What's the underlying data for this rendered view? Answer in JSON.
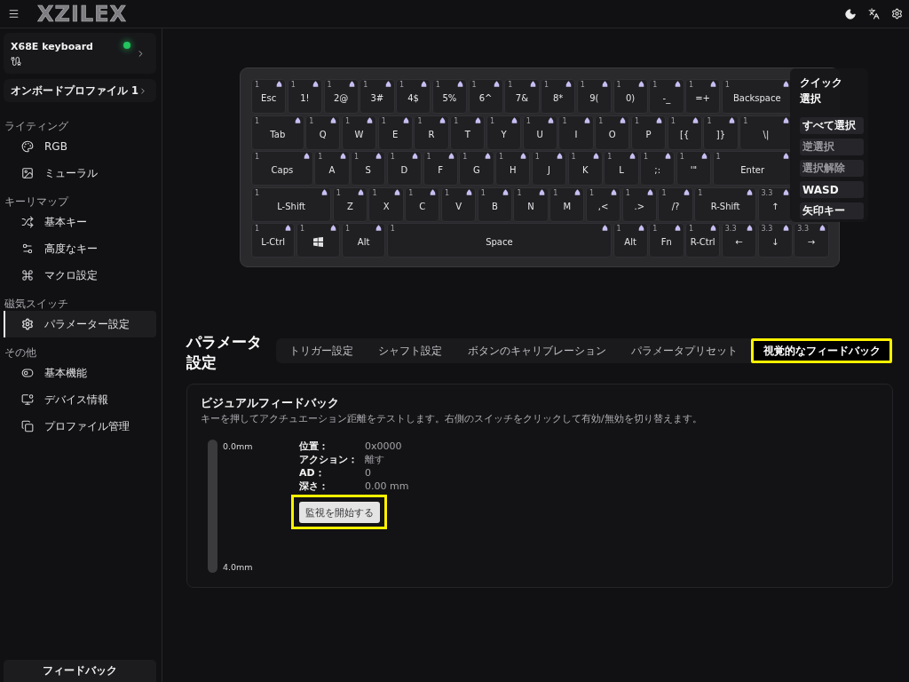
{
  "top_bar": {
    "logo": "XZILEX"
  },
  "sidebar": {
    "device": {
      "name": "X68E keyboard",
      "connected": true
    },
    "profile": "オンボードプロファイル 1",
    "sections": [
      {
        "title": "ライティング",
        "items": [
          {
            "label": "RGB",
            "selected": false
          },
          {
            "label": "ミューラル",
            "selected": false
          }
        ]
      },
      {
        "title": "キーリマップ",
        "items": [
          {
            "label": "基本キー",
            "selected": false
          },
          {
            "label": "高度なキー",
            "selected": false
          },
          {
            "label": "マクロ設定",
            "selected": false
          }
        ]
      },
      {
        "title": "磁気スイッチ",
        "items": [
          {
            "label": "パラメーター設定",
            "selected": true
          }
        ]
      },
      {
        "title": "その他",
        "items": [
          {
            "label": "基本機能",
            "selected": false
          },
          {
            "label": "デバイス情報",
            "selected": false
          },
          {
            "label": "プロファイル管理",
            "selected": false
          }
        ]
      }
    ],
    "feedback_button": "フィードバック"
  },
  "keyboard": {
    "rows": [
      {
        "keys": [
          {
            "kind": "text",
            "label": "Esc",
            "value": "1"
          },
          {
            "kind": "text",
            "label": "1!",
            "value": "1"
          },
          {
            "kind": "text",
            "label": "2@",
            "value": "1"
          },
          {
            "kind": "text",
            "label": "3#",
            "value": "1"
          },
          {
            "kind": "text",
            "label": "4$",
            "value": "1"
          },
          {
            "kind": "text",
            "label": "5%",
            "value": "1"
          },
          {
            "kind": "text",
            "label": "6^",
            "value": "1"
          },
          {
            "kind": "text",
            "label": "7&",
            "value": "1"
          },
          {
            "kind": "text",
            "label": "8*",
            "value": "1"
          },
          {
            "kind": "text",
            "label": "9(",
            "value": "1"
          },
          {
            "kind": "text",
            "label": "0)",
            "value": "1"
          },
          {
            "kind": "text",
            "label": "-_",
            "value": "1"
          },
          {
            "kind": "text",
            "label": "=+",
            "value": "1"
          },
          {
            "kind": "text",
            "label": "Backspace",
            "value": "1"
          }
        ]
      },
      {
        "keys": [
          {
            "kind": "text",
            "label": "Tab",
            "value": "1"
          },
          {
            "kind": "text",
            "label": "Q",
            "value": "1"
          },
          {
            "kind": "text",
            "label": "W",
            "value": "1"
          },
          {
            "kind": "text",
            "label": "E",
            "value": "1"
          },
          {
            "kind": "text",
            "label": "R",
            "value": "1"
          },
          {
            "kind": "text",
            "label": "T",
            "value": "1"
          },
          {
            "kind": "text",
            "label": "Y",
            "value": "1"
          },
          {
            "kind": "text",
            "label": "U",
            "value": "1"
          },
          {
            "kind": "text",
            "label": "I",
            "value": "1"
          },
          {
            "kind": "text",
            "label": "O",
            "value": "1"
          },
          {
            "kind": "text",
            "label": "P",
            "value": "1"
          },
          {
            "kind": "text",
            "label": "[{",
            "value": "1"
          },
          {
            "kind": "text",
            "label": "]}",
            "value": "1"
          },
          {
            "kind": "text",
            "label": "\\|",
            "value": "1"
          }
        ]
      },
      {
        "keys": [
          {
            "kind": "text",
            "label": "Caps",
            "value": "1"
          },
          {
            "kind": "text",
            "label": "A",
            "value": "1"
          },
          {
            "kind": "text",
            "label": "S",
            "value": "1"
          },
          {
            "kind": "text",
            "label": "D",
            "value": "1"
          },
          {
            "kind": "text",
            "label": "F",
            "value": "1"
          },
          {
            "kind": "text",
            "label": "G",
            "value": "1"
          },
          {
            "kind": "text",
            "label": "H",
            "value": "1"
          },
          {
            "kind": "text",
            "label": "J",
            "value": "1"
          },
          {
            "kind": "text",
            "label": "K",
            "value": "1"
          },
          {
            "kind": "text",
            "label": "L",
            "value": "1"
          },
          {
            "kind": "text",
            "label": ";:",
            "value": "1"
          },
          {
            "kind": "text",
            "label": "'\"",
            "value": "1"
          },
          {
            "kind": "text",
            "label": "Enter",
            "value": "1"
          }
        ]
      },
      {
        "keys": [
          {
            "kind": "text",
            "label": "L-Shift",
            "value": "1"
          },
          {
            "kind": "text",
            "label": "Z",
            "value": "1"
          },
          {
            "kind": "text",
            "label": "X",
            "value": "1"
          },
          {
            "kind": "text",
            "label": "C",
            "value": "1"
          },
          {
            "kind": "text",
            "label": "V",
            "value": "1"
          },
          {
            "kind": "text",
            "label": "B",
            "value": "1"
          },
          {
            "kind": "text",
            "label": "N",
            "value": "1"
          },
          {
            "kind": "text",
            "label": "M",
            "value": "1"
          },
          {
            "kind": "text",
            "label": ",<",
            "value": "1"
          },
          {
            "kind": "text",
            "label": ".>",
            "value": "1"
          },
          {
            "kind": "text",
            "label": "/?",
            "value": "1"
          },
          {
            "kind": "text",
            "label": "R-Shift",
            "value": "1"
          },
          {
            "kind": "text",
            "label": "↑",
            "value": "3.3"
          }
        ]
      },
      {
        "keys": [
          {
            "kind": "text",
            "label": "L-Ctrl",
            "value": "1"
          },
          {
            "kind": "logo",
            "value": "1"
          },
          {
            "kind": "text",
            "label": "Alt",
            "value": "1"
          },
          {
            "kind": "text",
            "label": "Space",
            "value": "1"
          },
          {
            "kind": "text",
            "label": "Alt",
            "value": "1"
          },
          {
            "kind": "text",
            "label": "Fn",
            "value": "1"
          },
          {
            "kind": "text",
            "label": "R-Ctrl",
            "value": "1"
          },
          {
            "kind": "text",
            "label": "←",
            "value": "3.3"
          },
          {
            "kind": "text",
            "label": "↓",
            "value": "3.3"
          },
          {
            "kind": "text",
            "label": "→",
            "value": "3.3"
          }
        ]
      }
    ]
  },
  "quick_select": {
    "title": "クイック選択",
    "buttons": [
      {
        "label": "すべて選択",
        "disabled": false
      },
      {
        "label": "逆選択",
        "disabled": true
      },
      {
        "label": "選択解除",
        "disabled": true
      },
      {
        "label": "WASD",
        "disabled": false
      },
      {
        "label": "矢印キー",
        "disabled": false
      }
    ]
  },
  "page_title": "パラメータ設定",
  "tabs": [
    {
      "label": "トリガー設定",
      "selected": false,
      "highlighted": false
    },
    {
      "label": "シャフト設定",
      "selected": false,
      "highlighted": false
    },
    {
      "label": "ボタンのキャリブレーション",
      "selected": false,
      "highlighted": false
    },
    {
      "label": "パラメータプリセット",
      "selected": false,
      "highlighted": false
    },
    {
      "label": "視覚的なフィードバック",
      "selected": true,
      "highlighted": true
    }
  ],
  "feedback_panel": {
    "title": "ビジュアルフィードバック",
    "description": "キーを押してアクチュエーション距離をテストします。右側のスイッチをクリックして有効/無効を切り替えます。",
    "depth_meter": {
      "level": 0,
      "top_label": "0.0mm",
      "bottom_label": "4.0mm"
    },
    "readings": [
      {
        "label": "位置：",
        "value": "0x0000"
      },
      {
        "label": "アクション：",
        "value": "離す"
      },
      {
        "label": "AD：",
        "value": "0"
      },
      {
        "label": "深さ：",
        "value": "0.00 mm"
      }
    ],
    "start_button": {
      "label": "監視を開始する",
      "highlighted": true
    }
  }
}
